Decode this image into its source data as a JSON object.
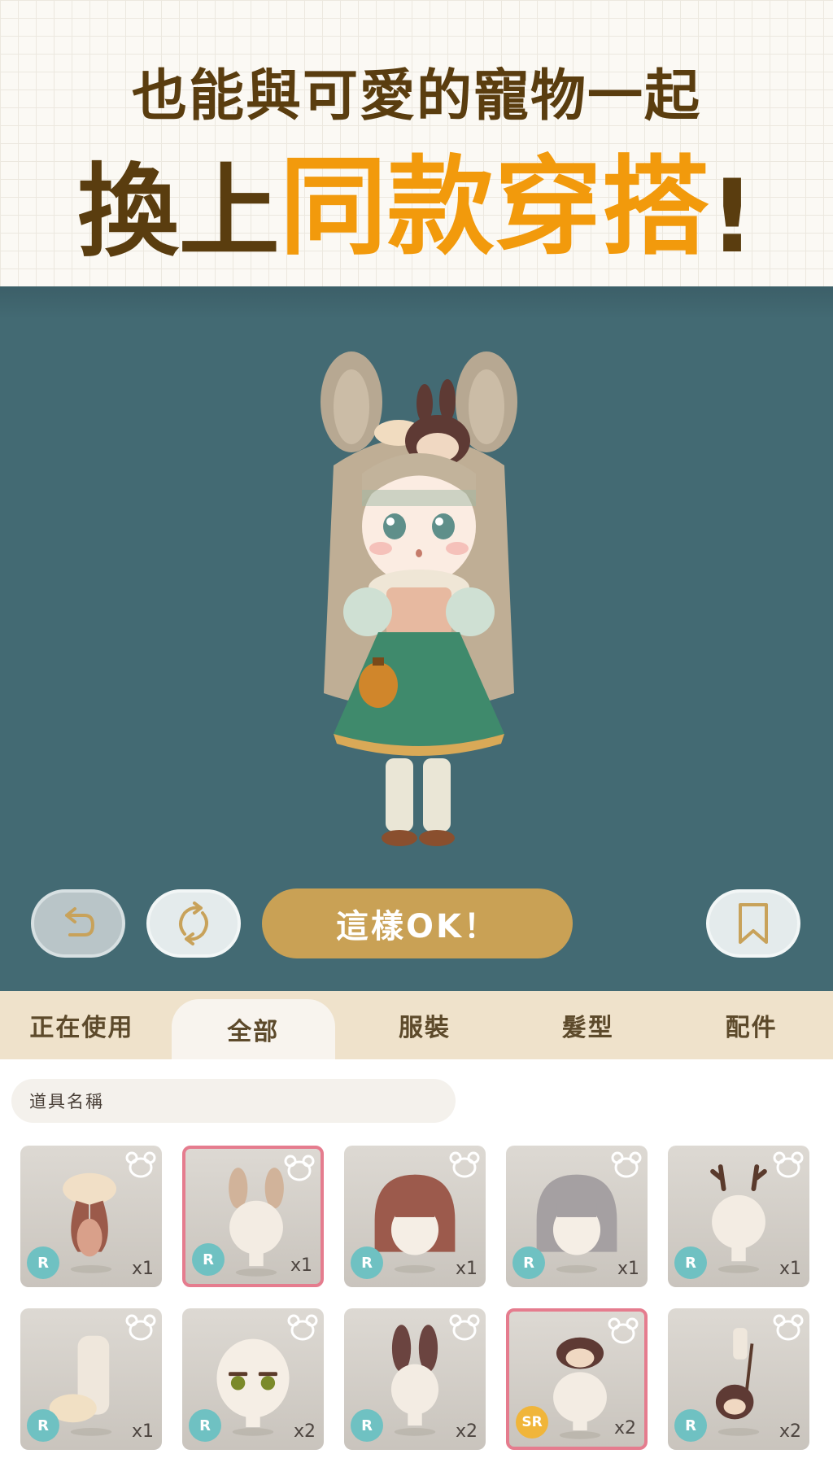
{
  "banner": {
    "line1": "也能與可愛的寵物一起",
    "line2_prefix": "換上",
    "line2_highlight": "同款穿搭",
    "line2_suffix": "!"
  },
  "stage": {
    "ok_button": "這樣OK！",
    "undo_icon": "undo-arrow",
    "refresh_icon": "refresh-arrows",
    "bookmark_icon": "bookmark"
  },
  "tabs": [
    {
      "label": "正在使用",
      "active": false
    },
    {
      "label": "全部",
      "active": true
    },
    {
      "label": "服裝",
      "active": false
    },
    {
      "label": "髮型",
      "active": false
    },
    {
      "label": "配件",
      "active": false
    }
  ],
  "search": {
    "placeholder": "道具名稱"
  },
  "items": [
    {
      "rarity": "R",
      "count": "x1",
      "selected": false,
      "art": "cream-bun-hair"
    },
    {
      "rarity": "R",
      "count": "x1",
      "selected": true,
      "art": "deer-ears"
    },
    {
      "rarity": "R",
      "count": "x1",
      "selected": false,
      "art": "brown-bob-hair"
    },
    {
      "rarity": "R",
      "count": "x1",
      "selected": false,
      "art": "gray-bob-hair"
    },
    {
      "rarity": "R",
      "count": "x1",
      "selected": false,
      "art": "antlers"
    },
    {
      "rarity": "R",
      "count": "x1",
      "selected": false,
      "art": "fur-tail"
    },
    {
      "rarity": "R",
      "count": "x2",
      "selected": false,
      "art": "green-eyes-face"
    },
    {
      "rarity": "R",
      "count": "x2",
      "selected": false,
      "art": "bunny-ears"
    },
    {
      "rarity": "SR",
      "count": "x2",
      "selected": true,
      "art": "bunny-pet-hat"
    },
    {
      "rarity": "R",
      "count": "x2",
      "selected": false,
      "art": "bunny-bag"
    }
  ],
  "colors": {
    "banner_text": "#5a3d0f",
    "highlight": "#f29a0c",
    "stage_bg": "#436a73",
    "ok_button": "#c9a155",
    "tab_bar": "#efe2cb",
    "selected_border": "#e57c8e",
    "rarity_r": "#6fc1c2",
    "rarity_sr": "#f0b53a"
  }
}
